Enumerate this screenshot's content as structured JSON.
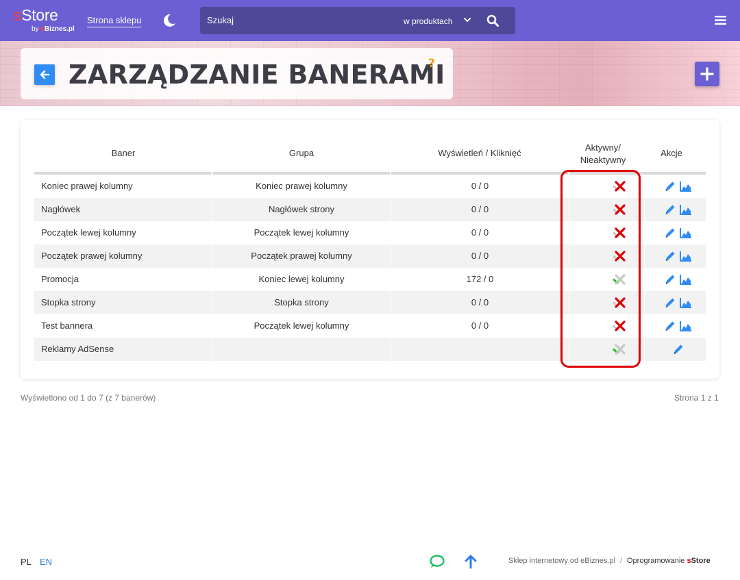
{
  "header": {
    "logo_s": "s",
    "logo_text": "Store",
    "logo_sub_prefix": "by ",
    "logo_sub_e": "e",
    "logo_sub_brand": "Biznes.pl",
    "shop_link": "Strona sklepu",
    "search_placeholder": "Szukaj",
    "search_scope": "w produktach"
  },
  "page": {
    "title": "ZARZĄDZANIE BANERAMI",
    "help": "?"
  },
  "table": {
    "headers": {
      "banner": "Baner",
      "group": "Grupa",
      "stats": "Wyświetleń / Kliknięć",
      "active_line1": "Aktywny/",
      "active_line2": "Nieaktywny",
      "actions": "Akcje"
    },
    "rows": [
      {
        "name": "Koniec prawej kolumny",
        "group": "Koniec prawej kolumny",
        "stats": "0 / 0",
        "active": false,
        "stats_icon": true
      },
      {
        "name": "Nagłówek",
        "group": "Nagłówek strony",
        "stats": "0 / 0",
        "active": false,
        "stats_icon": true
      },
      {
        "name": "Początek lewej kolumny",
        "group": "Początek lewej kolumny",
        "stats": "0 / 0",
        "active": false,
        "stats_icon": true
      },
      {
        "name": "Początek prawej kolumny",
        "group": "Początek prawej kolumny",
        "stats": "0 / 0",
        "active": false,
        "stats_icon": true
      },
      {
        "name": "Promocja",
        "group": "Koniec lewej kolumny",
        "stats": "172 / 0",
        "active": true,
        "stats_icon": true
      },
      {
        "name": "Stopka strony",
        "group": "Stopka strony",
        "stats": "0 / 0",
        "active": false,
        "stats_icon": true
      },
      {
        "name": "Test bannera",
        "group": "Początek lewej kolumny",
        "stats": "0 / 0",
        "active": false,
        "stats_icon": true
      },
      {
        "name": "Reklamy AdSense",
        "group": "",
        "stats": "",
        "active": true,
        "stats_icon": false
      }
    ]
  },
  "summary": "Wyświetlono od 1 do 7 (z 7 banerów)",
  "pagination": "Strona 1 z 1",
  "footer": {
    "lang_pl": "PL",
    "lang_en": "EN",
    "credit": "Sklep internetowy od eBiznes.pl",
    "software_prefix": "Oprogramowanie ",
    "software_s": "s",
    "software_store": "Store"
  },
  "colors": {
    "primary": "#6b5fd3",
    "accent_blue": "#2f8cf3",
    "check_green": "#1bc51b",
    "cross_red": "#e00000",
    "inactive_gray": "#c8c8c8"
  }
}
